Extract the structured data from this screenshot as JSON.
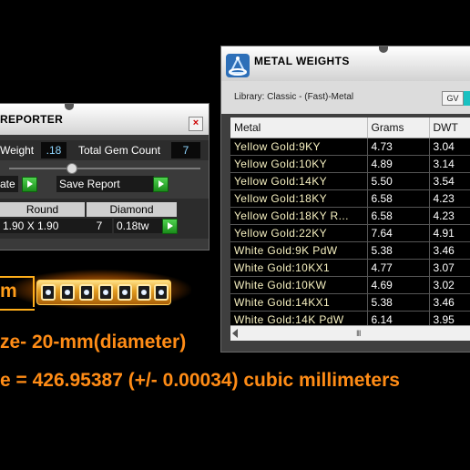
{
  "reporter": {
    "title": "REPORTER",
    "close_glyph": "×",
    "weight_label": "Weight",
    "weight_value": ".18",
    "total_gem_count_label": "Total Gem Count",
    "total_gem_count_value": "7",
    "left_button_label": "ate",
    "save_report_label": "Save Report",
    "table": {
      "headers": [
        "Round",
        "Diamond"
      ],
      "row": {
        "size": "1.90 X 1.90",
        "count": "7",
        "tw": "0.18tw"
      }
    }
  },
  "annotation": {
    "unit": "m",
    "size_text": "ze- 20-mm(diameter)",
    "volume_text": "e = 426.95387 (+/- 0.00034) cubic millimeters",
    "accent_color": "#ff8c16"
  },
  "metal_weights": {
    "title": "METAL WEIGHTS",
    "logo_icon": "ring-scale-logo-icon",
    "library_label": "Library: Classic - (Fast)-Metal",
    "gv_label": "GV",
    "columns": [
      "Metal",
      "Grams",
      "DWT"
    ],
    "rows": [
      {
        "metal": "Yellow Gold:9KY",
        "grams": "4.73",
        "dwt": "3.04"
      },
      {
        "metal": "Yellow Gold:10KY",
        "grams": "4.89",
        "dwt": "3.14"
      },
      {
        "metal": "Yellow Gold:14KY",
        "grams": "5.50",
        "dwt": "3.54"
      },
      {
        "metal": "Yellow Gold:18KY",
        "grams": "6.58",
        "dwt": "4.23"
      },
      {
        "metal": "Yellow Gold:18KY R...",
        "grams": "6.58",
        "dwt": "4.23"
      },
      {
        "metal": "Yellow Gold:22KY",
        "grams": "7.64",
        "dwt": "4.91"
      },
      {
        "metal": "White Gold:9K PdW",
        "grams": "5.38",
        "dwt": "3.46"
      },
      {
        "metal": "White Gold:10KX1",
        "grams": "4.77",
        "dwt": "3.07"
      },
      {
        "metal": "White Gold:10KW",
        "grams": "4.69",
        "dwt": "3.02"
      },
      {
        "metal": "White Gold:14KX1",
        "grams": "5.38",
        "dwt": "3.46"
      },
      {
        "metal": "White Gold:14K PdW",
        "grams": "6.14",
        "dwt": "3.95"
      }
    ],
    "scroll_thumb_glyph": "III"
  }
}
